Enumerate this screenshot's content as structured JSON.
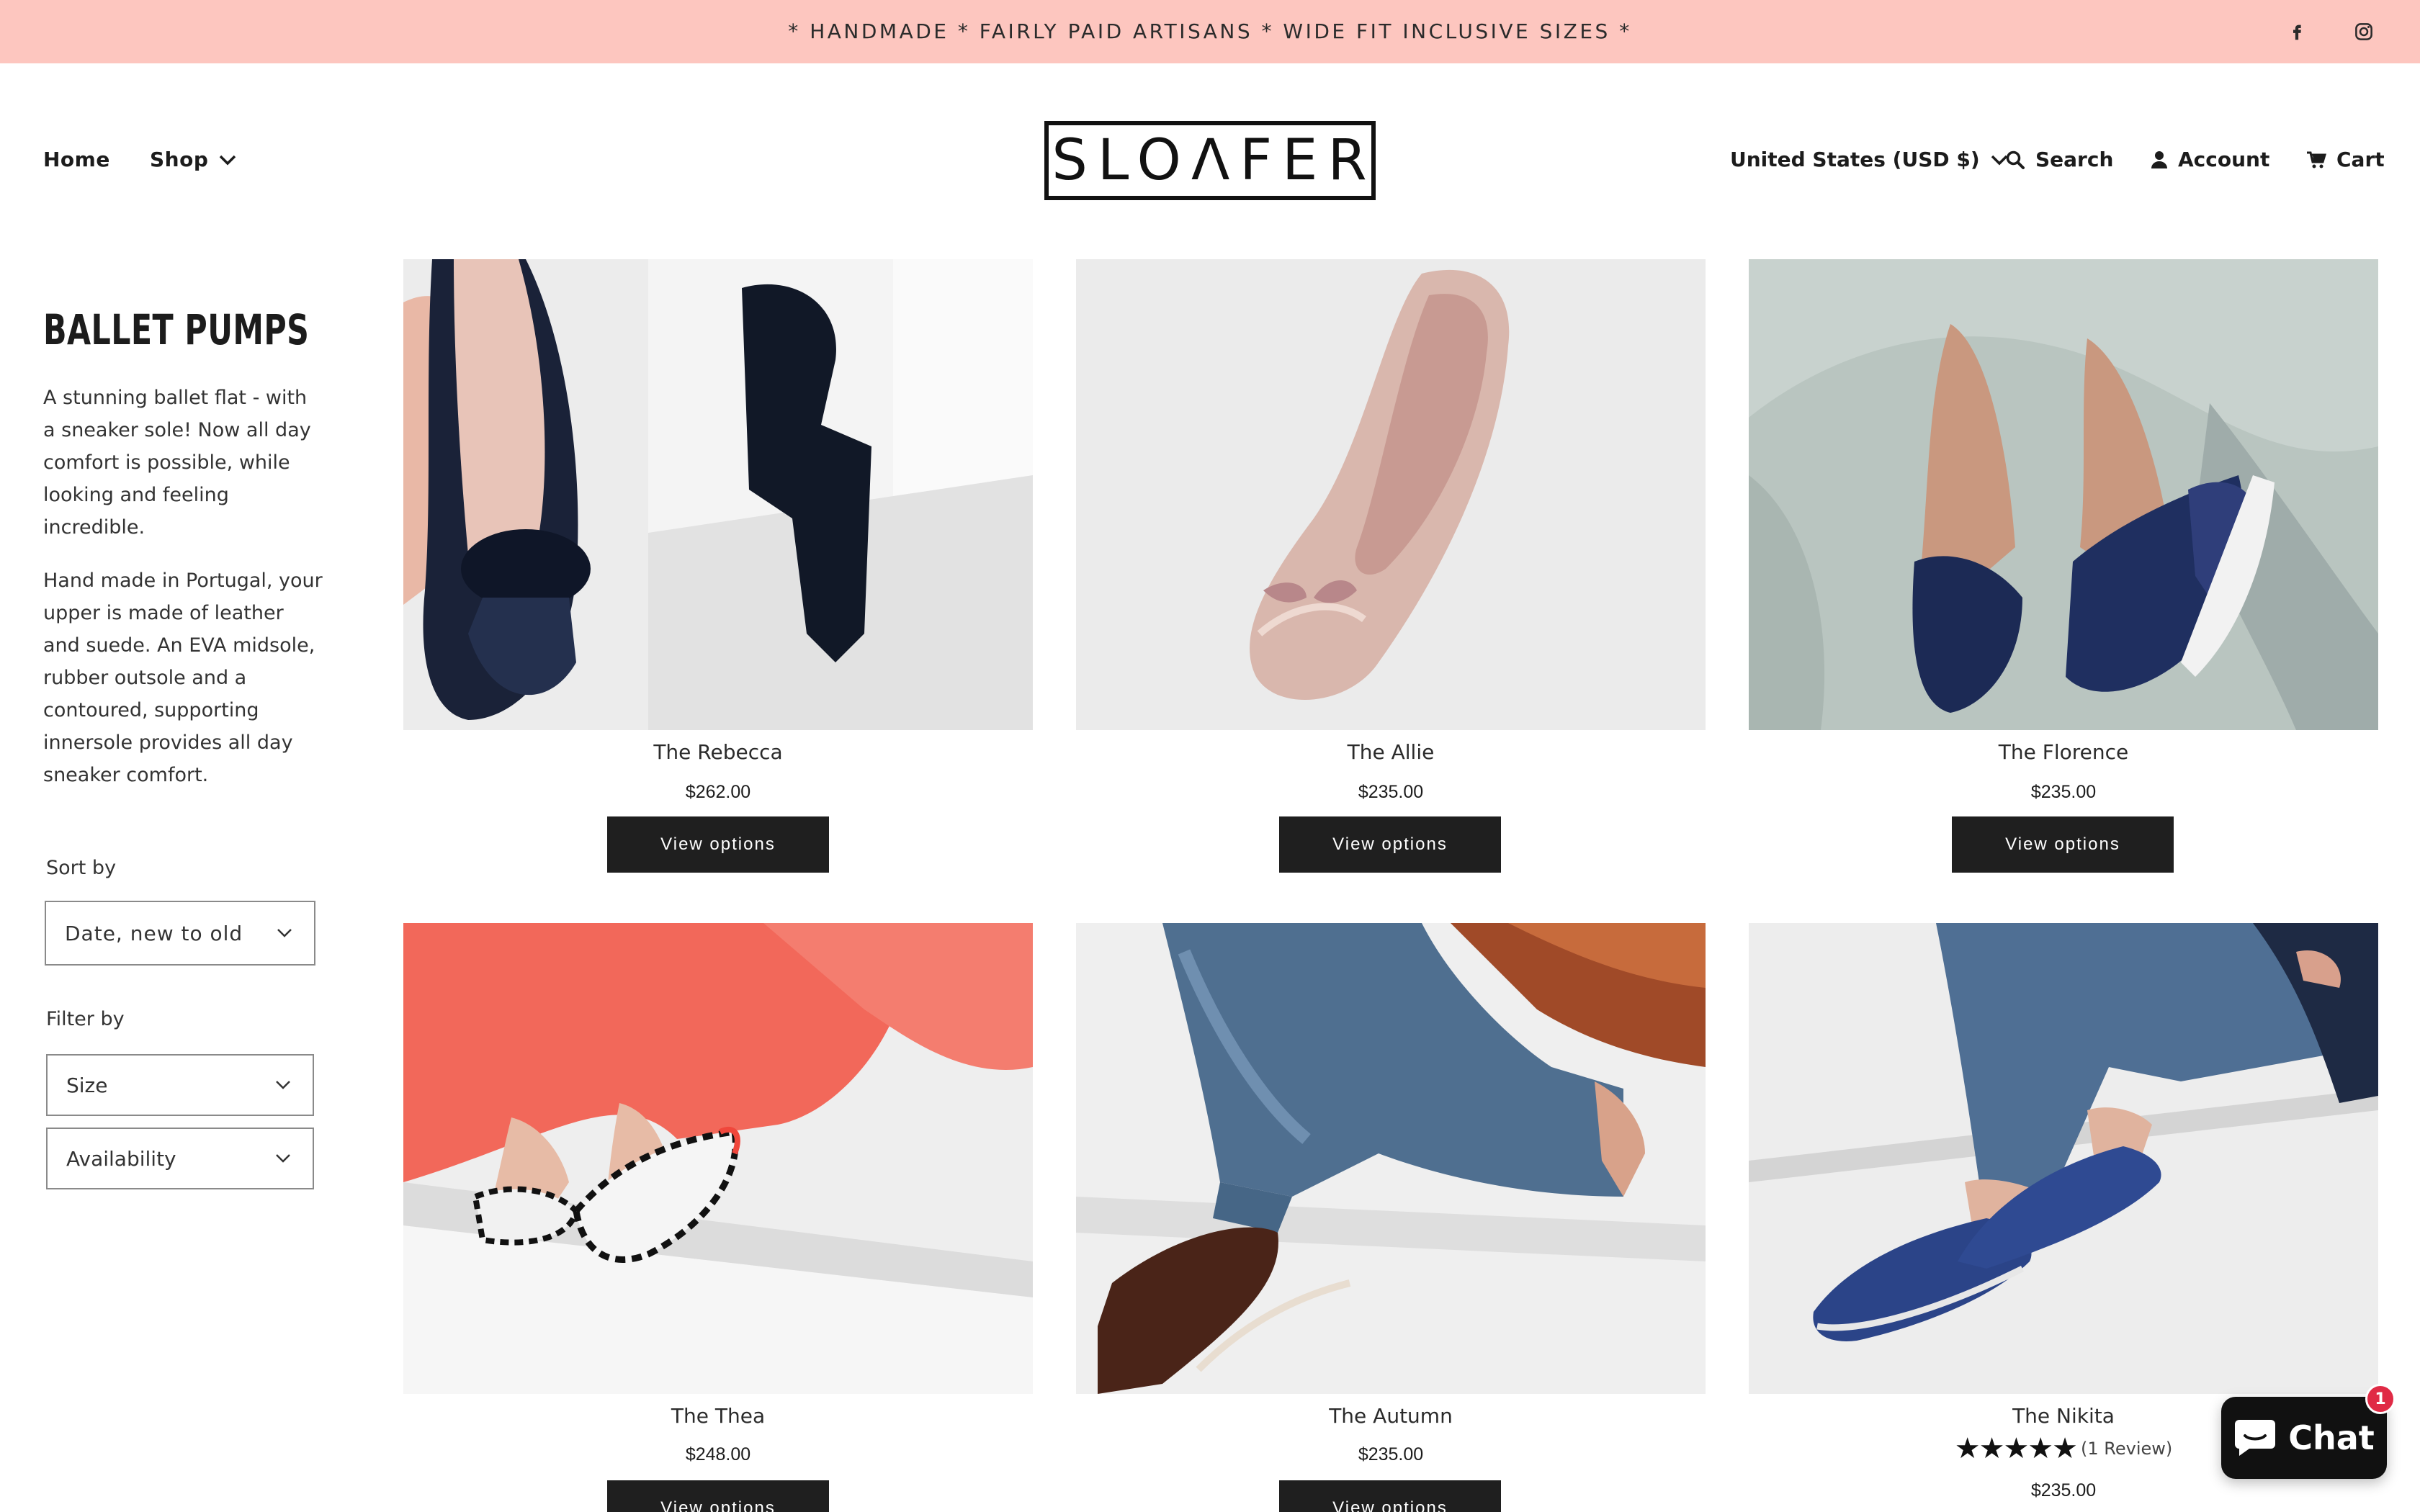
{
  "announcement": {
    "text": "* HANDMADE * FAIRLY PAID ARTISANS * WIDE FIT INCLUSIVE SIZES *",
    "background": "#fdc6bf",
    "social": [
      "facebook-icon",
      "instagram-icon"
    ]
  },
  "header": {
    "nav": [
      {
        "label": "Home"
      },
      {
        "label": "Shop",
        "icon": "chevron-down-icon"
      }
    ],
    "logo_text": "SLOΛFER",
    "currency": "United States (USD $)",
    "search_label": "Search",
    "account_label": "Account",
    "cart_label": "Cart"
  },
  "collection": {
    "title": "BALLET PUMPS",
    "description": [
      "A stunning ballet flat - with a sneaker sole!  Now all day comfort is possible, while looking and feeling incredible.",
      "Hand made in Portugal, your upper is made of leather and suede.  An EVA midsole, rubber outsole and a contoured, supporting innersole provides all day sneaker comfort."
    ],
    "sort": {
      "label": "Sort by",
      "value": "Date, new to old"
    },
    "filter": {
      "label": "Filter by",
      "options": [
        "Size",
        "Availability"
      ]
    }
  },
  "products": [
    {
      "title": "The Rebecca",
      "price": "$262.00",
      "button": "View options"
    },
    {
      "title": "The Allie",
      "price": "$235.00",
      "button": "View options"
    },
    {
      "title": "The Florence",
      "price": "$235.00",
      "button": "View options"
    },
    {
      "title": "The Thea",
      "price": "$248.00",
      "button": "View options"
    },
    {
      "title": "The Autumn",
      "price": "$235.00",
      "button": "View options"
    },
    {
      "title": "The Nikita",
      "price": "$235.00",
      "stars": "★★★★★",
      "reviews": "(1 Review)"
    }
  ],
  "chat": {
    "label": "Chat",
    "badge": "1"
  },
  "colors": {
    "button": "#1f1f1f",
    "accent_badge": "#e02a45"
  }
}
